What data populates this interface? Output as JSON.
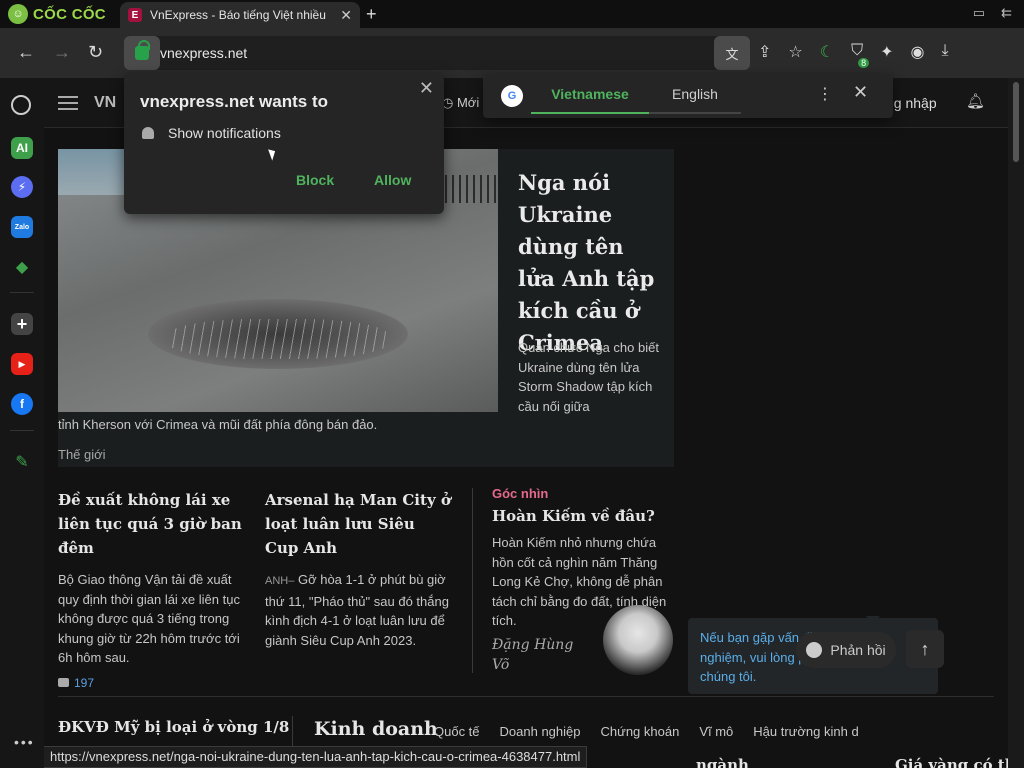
{
  "browser": {
    "logo_text": "CỐC CỐC",
    "tab_title": "VnExpress - Báo tiếng Việt nhiều",
    "tab_favicon": "E",
    "url": "vnexpress.net",
    "status_url": "https://vnexpress.net/nga-noi-ukraine-dung-ten-lua-anh-tap-kich-cau-o-crimea-4638477.html",
    "extension_badge": "8"
  },
  "notification_prompt": {
    "title": "vnexpress.net wants to",
    "permission": "Show notifications",
    "block_label": "Block",
    "allow_label": "Allow"
  },
  "translate_bar": {
    "source_lang": "Vietnamese",
    "target_lang": "English"
  },
  "sidebar": {
    "ai_label": "AI",
    "zalo_label": "Zalo"
  },
  "site_header": {
    "logo": "VN",
    "new_label": "Mới",
    "login_label": "ng nhập"
  },
  "featured": {
    "title": "Nga nói Ukraine dùng tên lửa Anh tập kích cầu ở Crimea",
    "desc": "Quan chức Nga cho biết Ukraine dùng tên lửa Storm Shadow tập kích cầu nối giữa",
    "desc_cont": "tỉnh Kherson với Crimea và mũi đất phía đông bán đảo.",
    "category": "Thế giới"
  },
  "articles": [
    {
      "title": "Đề xuất không lái xe liên tục quá 3 giờ ban đêm",
      "desc": "Bộ Giao thông Vận tải đề xuất quy định thời gian lái xe liên tục không được quá 3 tiếng trong khung giờ từ 22h hôm trước tới 6h hôm sau.",
      "comments": "197"
    },
    {
      "title": "Arsenal hạ Man City ở loạt luân lưu Siêu Cup Anh",
      "loc": "ANH–",
      "desc": "Gỡ hòa 1-1 ở phút bù giờ thứ 11, \"Pháo thủ\" sau đó thắng kình địch 4-1 ở loạt luân lưu để giành Siêu Cup Anh 2023."
    }
  ],
  "opinion": {
    "label": "Góc nhìn",
    "title": "Hoàn Kiếm về đâu?",
    "desc": "Hoàn Kiếm nhỏ nhưng chứa hồn cốt cả nghìn năm Thăng Long Kẻ Chợ, không dễ phân tách chỉ bằng đo đất, tính diện tích.",
    "author": "Đặng Hùng Võ"
  },
  "bottom": {
    "left_title": "ĐKVĐ Mỹ bị loại ở vòng 1/8",
    "section_title": "Kinh doanh",
    "tabs": [
      "Quốc tế",
      "Doanh nghiệp",
      "Chứng khoán",
      "Vĩ mô",
      "Hậu trường kinh d"
    ],
    "right_title": "Giá vàng có thể tăng trong",
    "partial_text": "ngành"
  },
  "feedback": {
    "message": "Nếu bạn gặp vấn đề khi trải nghiệm, vui lòng phản hồi tới chúng tôi.",
    "button_label": "Phản hồi"
  },
  "colors": {
    "accent_green": "#4fb35e",
    "opinion_pink": "#e46a8c",
    "feedback_blue": "#5aaee8"
  }
}
